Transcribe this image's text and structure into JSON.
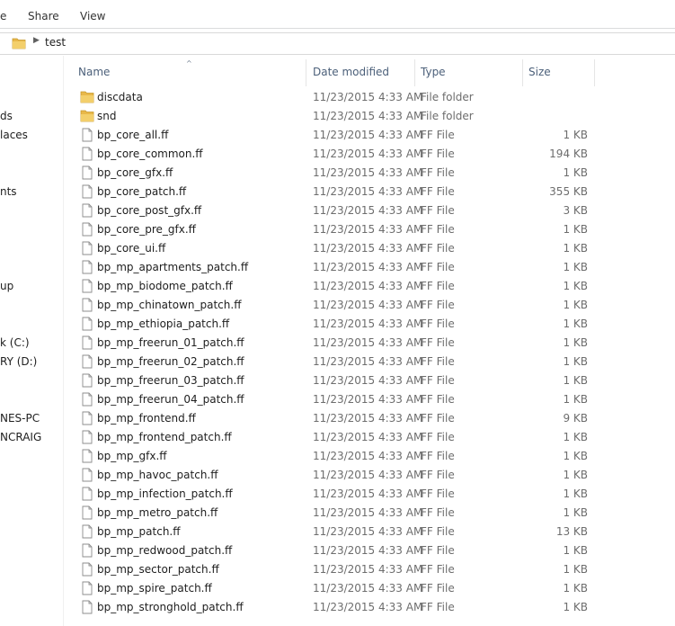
{
  "ribbon": {
    "tab_file": "e",
    "tab_share": "Share",
    "tab_view": "View"
  },
  "address": {
    "path": "test"
  },
  "nav": {
    "items": [
      "ds",
      "laces",
      "nts",
      "up",
      "k (C:)",
      "RY (D:)",
      "NES-PC",
      "NCRAIG"
    ]
  },
  "columns": {
    "name": "Name",
    "date": "Date modified",
    "type": "Type",
    "size": "Size"
  },
  "files": [
    {
      "name": "discdata",
      "date": "11/23/2015 4:33 AM",
      "type": "File folder",
      "size": "",
      "icon": "folder-icon"
    },
    {
      "name": "snd",
      "date": "11/23/2015 4:33 AM",
      "type": "File folder",
      "size": "",
      "icon": "folder-icon"
    },
    {
      "name": "bp_core_all.ff",
      "date": "11/23/2015 4:33 AM",
      "type": "FF File",
      "size": "1 KB",
      "icon": "file-icon"
    },
    {
      "name": "bp_core_common.ff",
      "date": "11/23/2015 4:33 AM",
      "type": "FF File",
      "size": "194 KB",
      "icon": "file-icon"
    },
    {
      "name": "bp_core_gfx.ff",
      "date": "11/23/2015 4:33 AM",
      "type": "FF File",
      "size": "1 KB",
      "icon": "file-icon"
    },
    {
      "name": "bp_core_patch.ff",
      "date": "11/23/2015 4:33 AM",
      "type": "FF File",
      "size": "355 KB",
      "icon": "file-icon"
    },
    {
      "name": "bp_core_post_gfx.ff",
      "date": "11/23/2015 4:33 AM",
      "type": "FF File",
      "size": "3 KB",
      "icon": "file-icon"
    },
    {
      "name": "bp_core_pre_gfx.ff",
      "date": "11/23/2015 4:33 AM",
      "type": "FF File",
      "size": "1 KB",
      "icon": "file-icon"
    },
    {
      "name": "bp_core_ui.ff",
      "date": "11/23/2015 4:33 AM",
      "type": "FF File",
      "size": "1 KB",
      "icon": "file-icon"
    },
    {
      "name": "bp_mp_apartments_patch.ff",
      "date": "11/23/2015 4:33 AM",
      "type": "FF File",
      "size": "1 KB",
      "icon": "file-icon"
    },
    {
      "name": "bp_mp_biodome_patch.ff",
      "date": "11/23/2015 4:33 AM",
      "type": "FF File",
      "size": "1 KB",
      "icon": "file-icon"
    },
    {
      "name": "bp_mp_chinatown_patch.ff",
      "date": "11/23/2015 4:33 AM",
      "type": "FF File",
      "size": "1 KB",
      "icon": "file-icon"
    },
    {
      "name": "bp_mp_ethiopia_patch.ff",
      "date": "11/23/2015 4:33 AM",
      "type": "FF File",
      "size": "1 KB",
      "icon": "file-icon"
    },
    {
      "name": "bp_mp_freerun_01_patch.ff",
      "date": "11/23/2015 4:33 AM",
      "type": "FF File",
      "size": "1 KB",
      "icon": "file-icon"
    },
    {
      "name": "bp_mp_freerun_02_patch.ff",
      "date": "11/23/2015 4:33 AM",
      "type": "FF File",
      "size": "1 KB",
      "icon": "file-icon"
    },
    {
      "name": "bp_mp_freerun_03_patch.ff",
      "date": "11/23/2015 4:33 AM",
      "type": "FF File",
      "size": "1 KB",
      "icon": "file-icon"
    },
    {
      "name": "bp_mp_freerun_04_patch.ff",
      "date": "11/23/2015 4:33 AM",
      "type": "FF File",
      "size": "1 KB",
      "icon": "file-icon"
    },
    {
      "name": "bp_mp_frontend.ff",
      "date": "11/23/2015 4:33 AM",
      "type": "FF File",
      "size": "9 KB",
      "icon": "file-icon"
    },
    {
      "name": "bp_mp_frontend_patch.ff",
      "date": "11/23/2015 4:33 AM",
      "type": "FF File",
      "size": "1 KB",
      "icon": "file-icon"
    },
    {
      "name": "bp_mp_gfx.ff",
      "date": "11/23/2015 4:33 AM",
      "type": "FF File",
      "size": "1 KB",
      "icon": "file-icon"
    },
    {
      "name": "bp_mp_havoc_patch.ff",
      "date": "11/23/2015 4:33 AM",
      "type": "FF File",
      "size": "1 KB",
      "icon": "file-icon"
    },
    {
      "name": "bp_mp_infection_patch.ff",
      "date": "11/23/2015 4:33 AM",
      "type": "FF File",
      "size": "1 KB",
      "icon": "file-icon"
    },
    {
      "name": "bp_mp_metro_patch.ff",
      "date": "11/23/2015 4:33 AM",
      "type": "FF File",
      "size": "1 KB",
      "icon": "file-icon"
    },
    {
      "name": "bp_mp_patch.ff",
      "date": "11/23/2015 4:33 AM",
      "type": "FF File",
      "size": "13 KB",
      "icon": "file-icon"
    },
    {
      "name": "bp_mp_redwood_patch.ff",
      "date": "11/23/2015 4:33 AM",
      "type": "FF File",
      "size": "1 KB",
      "icon": "file-icon"
    },
    {
      "name": "bp_mp_sector_patch.ff",
      "date": "11/23/2015 4:33 AM",
      "type": "FF File",
      "size": "1 KB",
      "icon": "file-icon"
    },
    {
      "name": "bp_mp_spire_patch.ff",
      "date": "11/23/2015 4:33 AM",
      "type": "FF File",
      "size": "1 KB",
      "icon": "file-icon"
    },
    {
      "name": "bp_mp_stronghold_patch.ff",
      "date": "11/23/2015 4:33 AM",
      "type": "FF File",
      "size": "1 KB",
      "icon": "file-icon"
    }
  ],
  "colors": {
    "folder_yellow": "#e8b84a",
    "header_text": "#4c607a",
    "meta_text": "#6d6d6d"
  }
}
